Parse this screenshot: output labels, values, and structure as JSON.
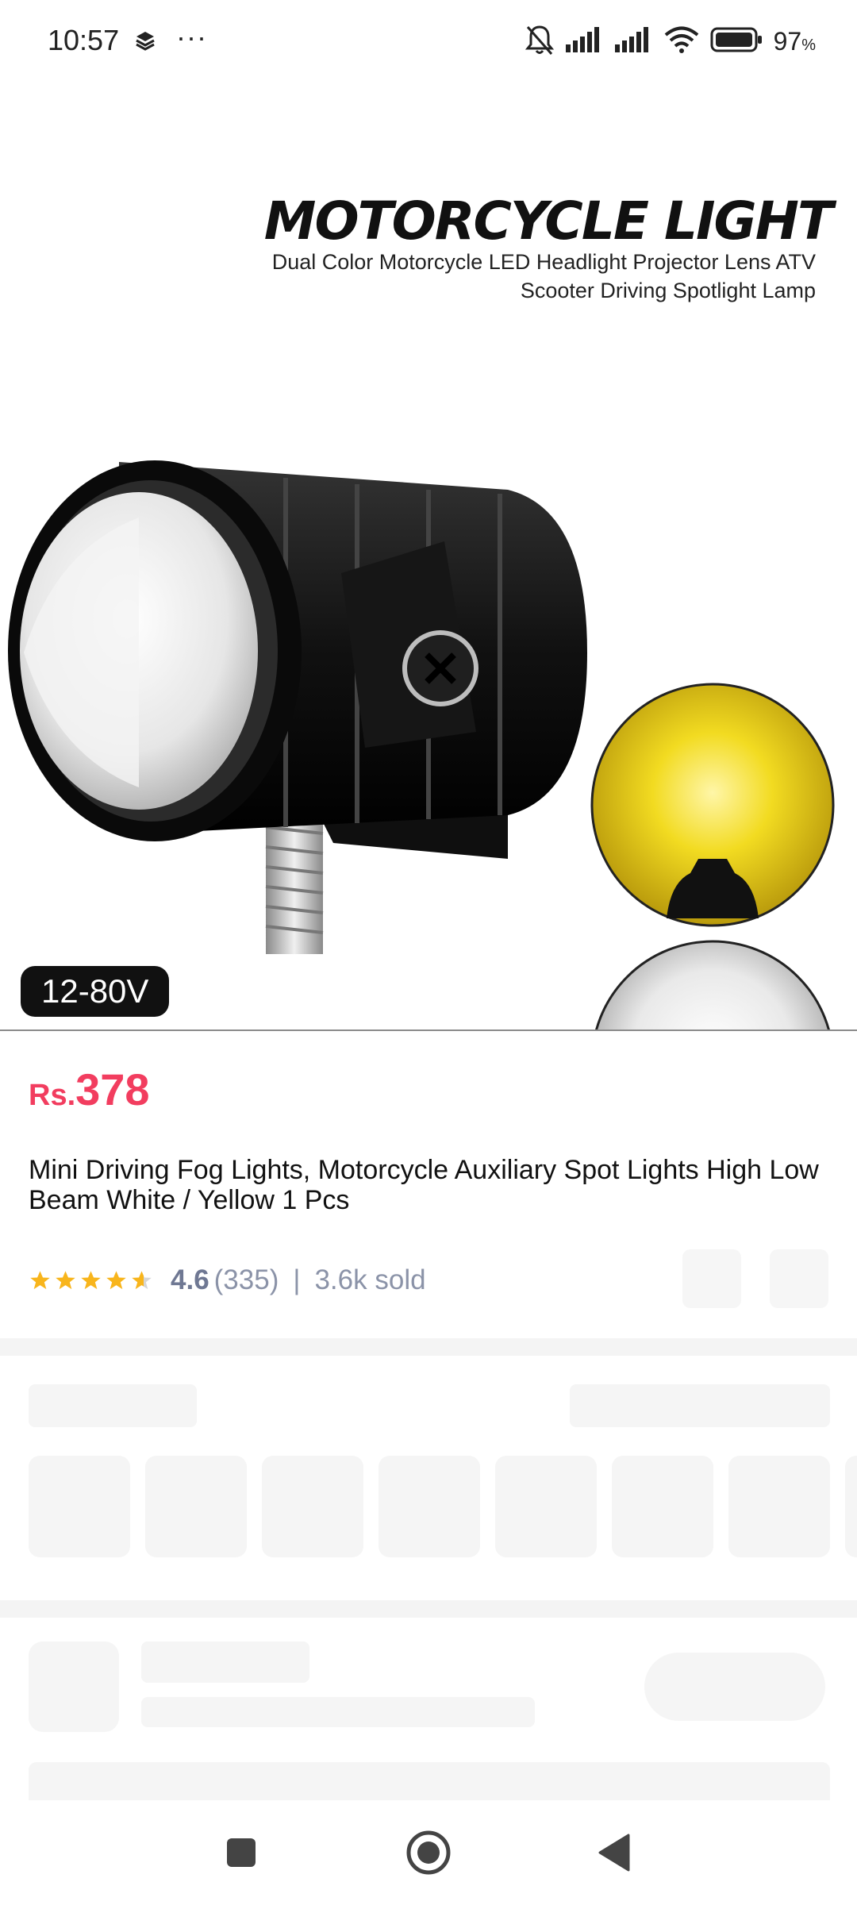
{
  "status_bar": {
    "time": "10:57",
    "overflow": "···",
    "battery_percent": "97",
    "battery_suffix": "%",
    "icons": [
      "layers-icon",
      "mute-icon",
      "signal-icon",
      "signal-icon",
      "wifi-icon",
      "battery-icon"
    ]
  },
  "product_image": {
    "heading": "MOTORCYCLE LIGHT",
    "subheading": "Dual Color Motorcycle LED Headlight Projector Lens ATV Scooter Driving Spotlight Lamp",
    "voltage_badge": "12-80V"
  },
  "product": {
    "currency": "Rs.",
    "price": "378",
    "title": "Mini Driving Fog Lights, Motorcycle Auxiliary Spot Lights High Low Beam White / Yellow 1 Pcs",
    "rating": 4.6,
    "rating_text": "4.6",
    "reviews": "(335)",
    "separator": "|",
    "sold": "3.6k sold"
  },
  "colors": {
    "price": "#f23d5f",
    "star": "#f8b51c",
    "muted_text": "#8b93a8",
    "skeleton": "#f5f5f5"
  },
  "nav": {
    "icons": [
      "recents-square-icon",
      "home-circle-icon",
      "back-triangle-icon"
    ]
  }
}
